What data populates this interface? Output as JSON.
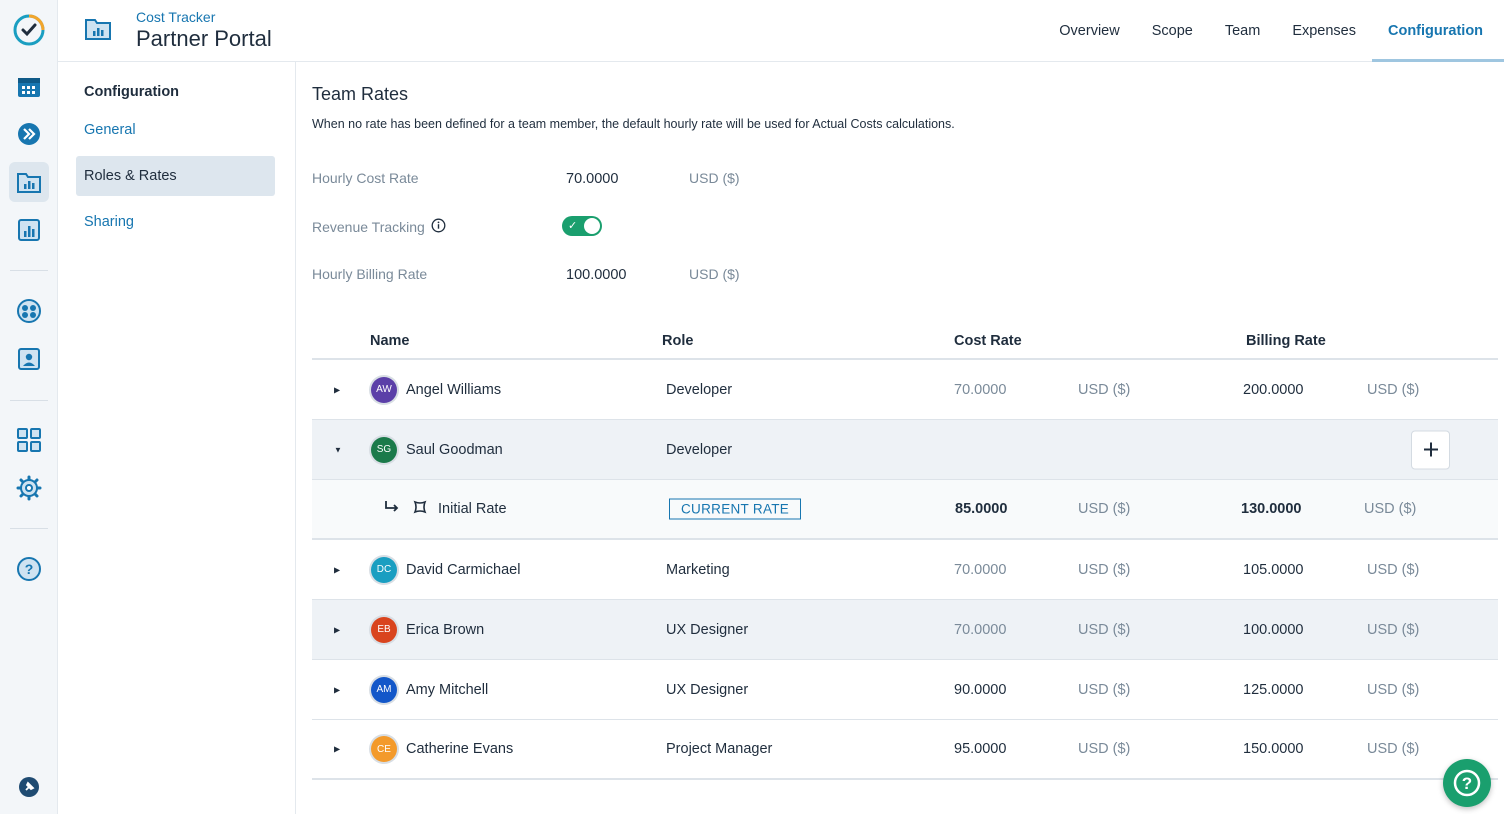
{
  "header": {
    "subtitle": "Cost Tracker",
    "title": "Partner Portal",
    "tabs": [
      {
        "label": "Overview"
      },
      {
        "label": "Scope"
      },
      {
        "label": "Team"
      },
      {
        "label": "Expenses"
      },
      {
        "label": "Configuration",
        "active": true
      }
    ]
  },
  "rail": {
    "icons": [
      "app-logo-icon",
      "calendar-icon",
      "forward-icon",
      "folder-chart-icon",
      "bar-chart-icon",
      "globe-icon",
      "contact-icon",
      "grid-icon",
      "gear-icon",
      "help-icon",
      "pin-icon"
    ]
  },
  "config_nav": {
    "heading": "Configuration",
    "items": [
      {
        "label": "General"
      },
      {
        "label": "Roles & Rates",
        "active": true
      },
      {
        "label": "Sharing"
      }
    ]
  },
  "team_rates": {
    "title": "Team Rates",
    "description": "When no rate has been defined for a team member, the default hourly rate will be used for Actual Costs calculations.",
    "hourly_cost": {
      "label": "Hourly Cost Rate",
      "value": "70.0000",
      "unit": "USD ($)"
    },
    "revenue_tracking": {
      "label": "Revenue Tracking",
      "enabled": true
    },
    "hourly_billing": {
      "label": "Hourly Billing Rate",
      "value": "100.0000",
      "unit": "USD ($)"
    }
  },
  "table": {
    "headers": {
      "name": "Name",
      "role": "Role",
      "cost": "Cost Rate",
      "billing": "Billing Rate"
    },
    "rows": [
      {
        "initials": "AW",
        "name": "Angel Williams",
        "role": "Developer",
        "cost": "70.0000",
        "cost_unit": "USD ($)",
        "billing": "200.0000",
        "billing_unit": "USD ($)",
        "color": "#5b3fa8"
      },
      {
        "initials": "SG",
        "name": "Saul Goodman",
        "role": "Developer",
        "color": "#1b7a4a",
        "expanded": true
      },
      {
        "initials": "DC",
        "name": "David Carmichael",
        "role": "Marketing",
        "cost": "70.0000",
        "cost_unit": "USD ($)",
        "billing": "105.0000",
        "billing_unit": "USD ($)",
        "color": "#1a9ec1"
      },
      {
        "initials": "EB",
        "name": "Erica Brown",
        "role": "UX Designer",
        "cost": "70.0000",
        "cost_unit": "USD ($)",
        "billing": "100.0000",
        "billing_unit": "USD ($)",
        "color": "#d9441e"
      },
      {
        "initials": "AM",
        "name": "Amy Mitchell",
        "role": "UX Designer",
        "cost": "90.0000",
        "cost_unit": "USD ($)",
        "billing": "125.0000",
        "billing_unit": "USD ($)",
        "color": "#1357c9"
      },
      {
        "initials": "CE",
        "name": "Catherine Evans",
        "role": "Project Manager",
        "cost": "95.0000",
        "cost_unit": "USD ($)",
        "billing": "150.0000",
        "billing_unit": "USD ($)",
        "color": "#f39a2b"
      }
    ],
    "subrow": {
      "name": "Initial Rate",
      "badge": "CURRENT RATE",
      "cost": "85.0000",
      "cost_unit": "USD ($)",
      "billing": "130.0000",
      "billing_unit": "USD ($)"
    }
  }
}
